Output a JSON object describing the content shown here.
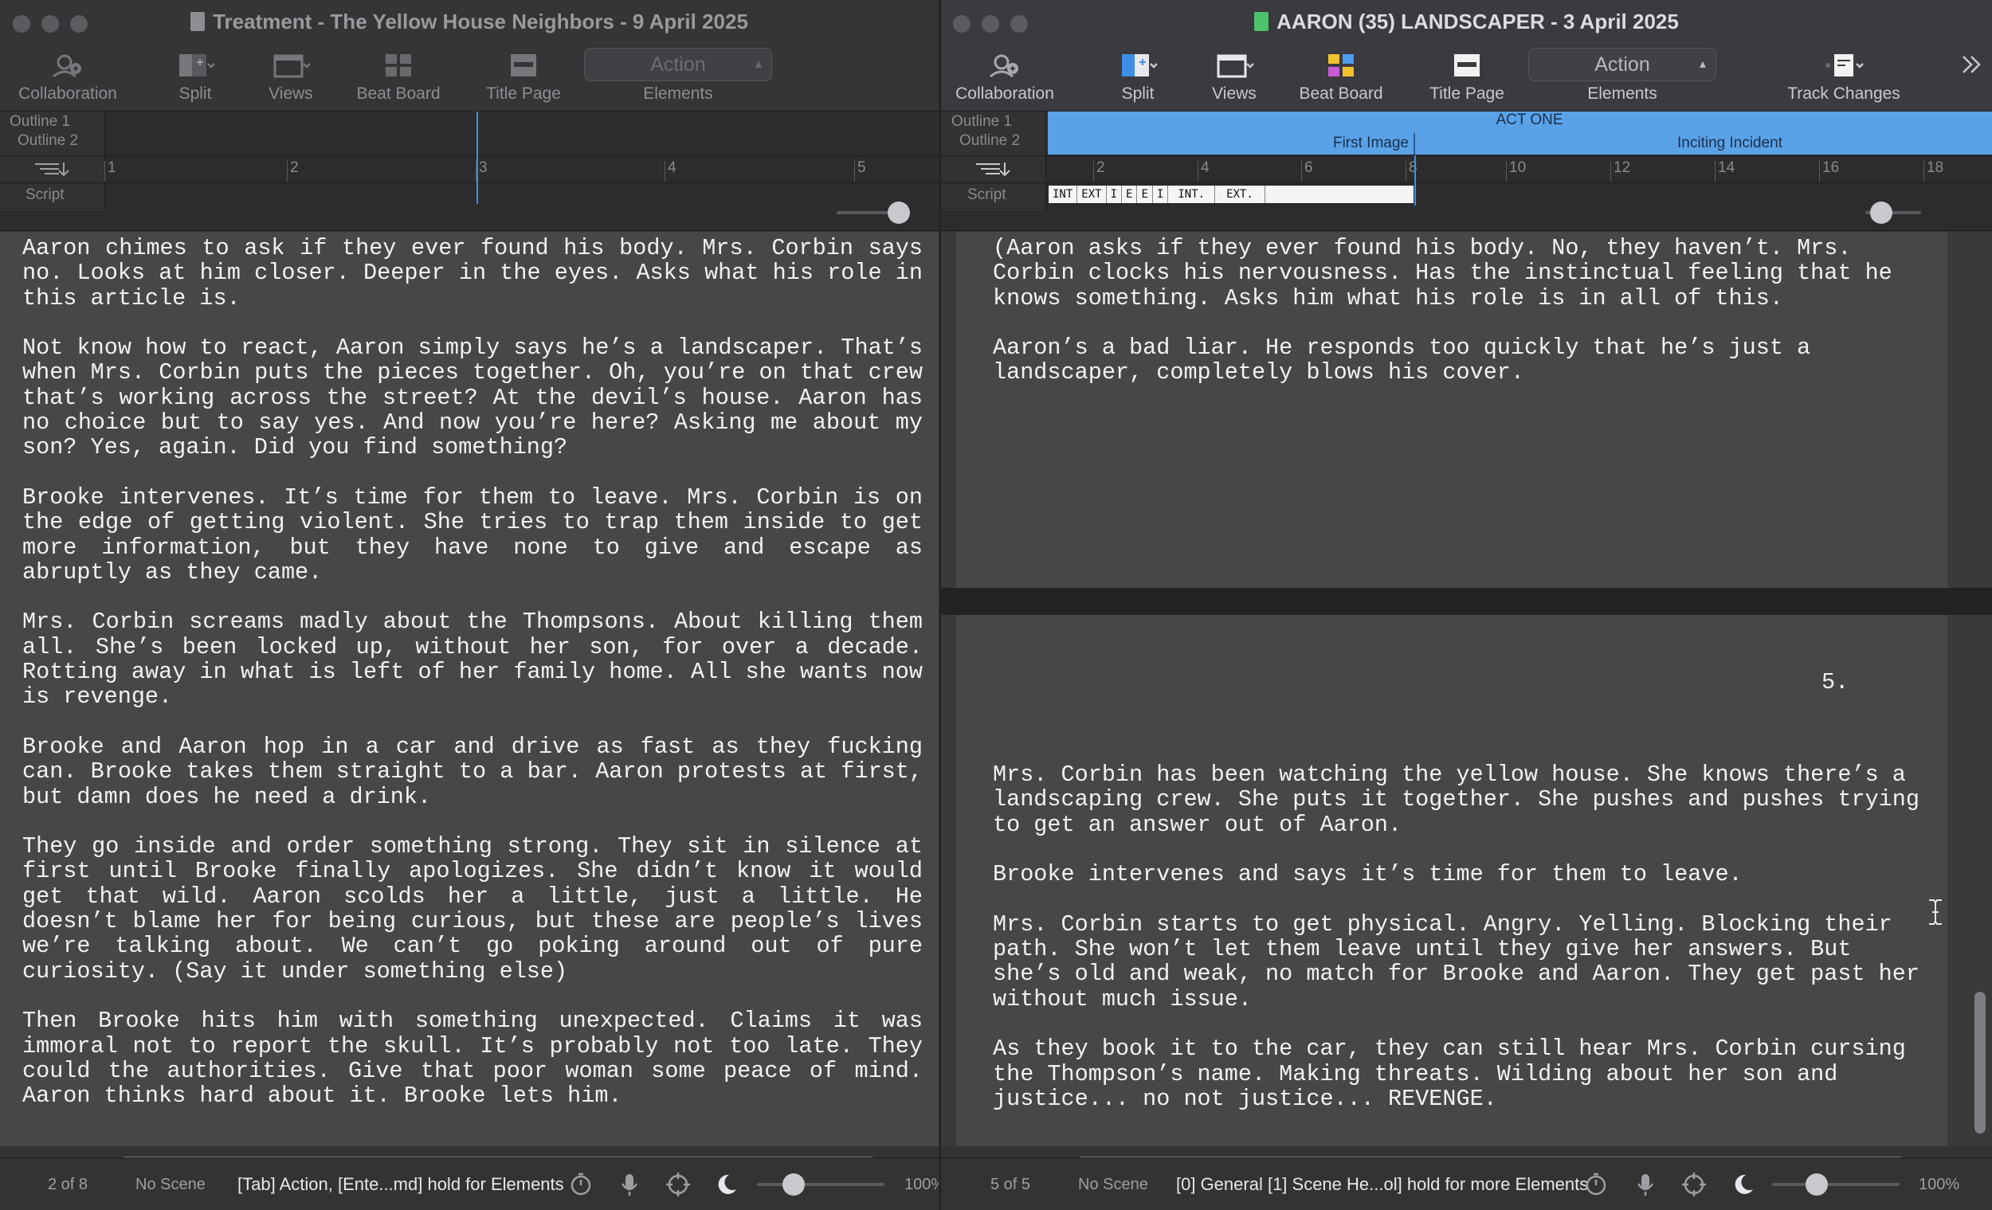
{
  "left_window": {
    "title": "Treatment - The Yellow House Neighbors - 9 April 2025",
    "toolbar": {
      "collaboration": "Collaboration",
      "split": "Split",
      "views": "Views",
      "beat_board": "Beat Board",
      "title_page": "Title Page",
      "element_value": "Action",
      "elements": "Elements"
    },
    "outline": {
      "outline1": "Outline 1",
      "outline2": "Outline 2",
      "script": "Script",
      "ruler_ticks": [
        "1",
        "2",
        "3",
        "4",
        "5"
      ]
    },
    "paragraphs": [
      "Aaron chimes to ask if they ever found his body. Mrs. Corbin says no. Looks at him closer. Deeper in the eyes. Asks what his role in this article is.",
      "Not know how to react, Aaron simply says he’s a landscaper. That’s when Mrs. Corbin puts the pieces together. Oh, you’re on that crew that’s working across the street? At the devil’s house. Aaron has no choice but to say yes. And now you’re here? Asking me about my son? Yes, again. Did you find something?",
      "Brooke intervenes. It’s time for them to leave. Mrs. Corbin is on the edge of getting violent. She tries to trap them inside to get more information, but they have none to give and escape as abruptly as they came.",
      "Mrs. Corbin screams madly about the Thompsons. About killing them all. She’s been locked up, without her son, for over a decade. Rotting away in what is left of her family home. All she wants now is revenge.",
      "Brooke and Aaron hop in a car and drive as fast as they fucking can. Brooke takes them straight to a bar. Aaron protests at first, but damn does he need a drink.",
      "They go inside and order something strong. They sit in silence at first until Brooke finally apologizes. She didn’t know it would get that wild. Aaron scolds her a little, just a little. He doesn’t blame her for being curious, but these are people’s lives we’re talking about. We can’t go poking around out of pure curiosity. (Say it under something else)",
      "Then Brooke hits him with something unexpected. Claims it was immoral not to report the skull. It’s probably not too late. They could the authorities. Give that poor woman some peace of mind. Aaron thinks hard about it. Brooke lets him."
    ],
    "status": {
      "page": "2 of 8",
      "scene": "No Scene",
      "hint": "[Tab]  Action,  [Ente...md] hold for Elements",
      "zoom": "100%"
    }
  },
  "right_window": {
    "title": "AARON (35) LANDSCAPER - 3 April 2025",
    "toolbar": {
      "collaboration": "Collaboration",
      "split": "Split",
      "views": "Views",
      "beat_board": "Beat Board",
      "title_page": "Title Page",
      "element_value": "Action",
      "elements": "Elements",
      "track_changes": "Track Changes"
    },
    "outline": {
      "outline1": "Outline 1",
      "outline2": "Outline 2",
      "script": "Script",
      "act_one": "ACT ONE",
      "first_image": "First Image",
      "inciting_incident": "Inciting Incident",
      "ruler_ticks": [
        "2",
        "4",
        "6",
        "8",
        "10",
        "12",
        "14",
        "16",
        "18"
      ],
      "scene_strip": [
        "INT",
        "EXT",
        "I",
        "E",
        "E",
        "I",
        "INT.",
        "EXT."
      ]
    },
    "page_top_paragraphs": [
      "(Aaron asks if they ever found his body. No, they haven’t. Mrs. Corbin clocks his nervousness. Has the instinctual feeling that he knows something. Asks him what his role is in all of this.",
      "Aaron’s a bad liar. He responds too quickly that he’s just a landscaper, completely blows his cover."
    ],
    "page_number": "5.",
    "page_bottom_paragraphs": [
      "Mrs. Corbin has been watching the yellow house. She knows there’s a landscaping crew. She puts it together. She pushes and pushes trying to get an answer out of Aaron.",
      "Brooke intervenes and says it’s time for them to leave.",
      "Mrs. Corbin starts to get physical. Angry. Yelling. Blocking their path. She won’t let them leave until they give her answers. But she’s old and weak, no match for Brooke and Aaron. They get past her without much issue.",
      "As they book it to the car, they can still hear Mrs. Corbin cursing the Thompson’s name. Making threats. Wilding about her son and justice... no not justice... REVENGE."
    ],
    "status": {
      "page": "5 of 5",
      "scene": "No Scene",
      "hint": "[0] General [1] Scene He...ol] hold for more Elements",
      "zoom": "100%"
    }
  }
}
